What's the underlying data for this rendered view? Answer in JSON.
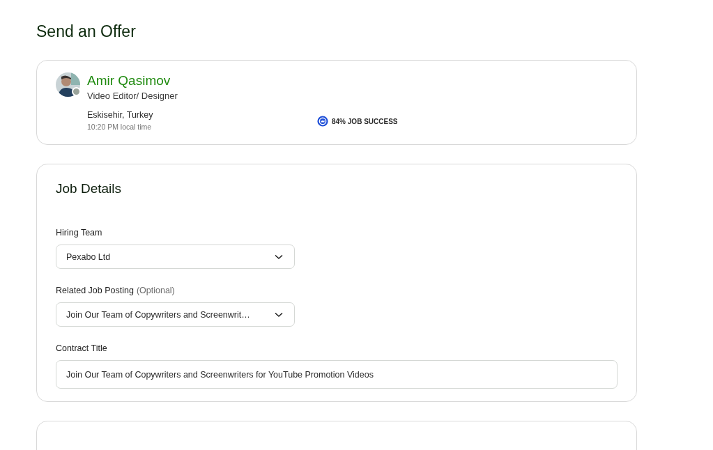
{
  "page_title": "Send an Offer",
  "freelancer": {
    "name": "Amir Qasimov",
    "title": "Video Editor/ Designer",
    "location": "Eskisehir, Turkey",
    "local_time": "10:20 PM local time",
    "job_success": "84% JOB SUCCESS"
  },
  "job_details": {
    "heading": "Job Details",
    "fields": [
      {
        "kind": "select",
        "label": "Hiring Team",
        "value": "Pexabo Ltd"
      },
      {
        "kind": "select",
        "label": "Related Job Posting",
        "hint": "(Optional)",
        "value": "Join Our Team of Copywriters and Screenwrit…"
      },
      {
        "kind": "text",
        "label": "Contract Title",
        "value": "Join Our Team of Copywriters and Screenwriters for YouTube Promotion Videos"
      }
    ]
  }
}
